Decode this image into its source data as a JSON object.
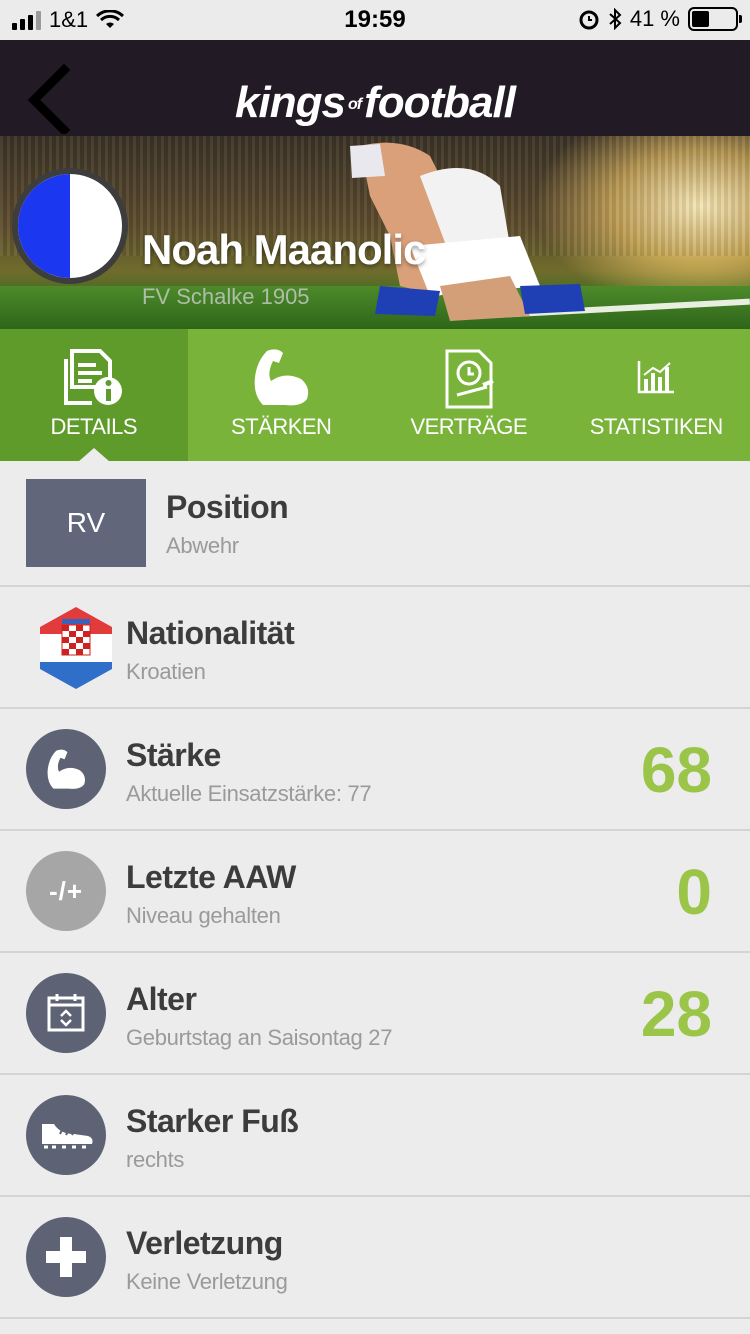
{
  "status_bar": {
    "carrier": "1&1",
    "time": "19:59",
    "battery_percent": "41 %",
    "battery_level": 0.41
  },
  "nav": {
    "back_icon": "chevron-left-icon",
    "logo_part1": "kings",
    "logo_part2": "of",
    "logo_part3": "football"
  },
  "player": {
    "name": "Noah Maanolic",
    "club": "FV Schalke 1905",
    "club_colors": [
      "#1b38f0",
      "#ffffff"
    ]
  },
  "tabs": [
    {
      "label": "DETAILS",
      "icon": "details-document-icon",
      "active": true
    },
    {
      "label": "STÄRKEN",
      "icon": "flexed-arm-icon",
      "active": false
    },
    {
      "label": "VERTRÄGE",
      "icon": "contract-clock-icon",
      "active": false
    },
    {
      "label": "STATISTIKEN",
      "icon": "bar-chart-icon",
      "active": false
    }
  ],
  "details": {
    "position": {
      "badge": "RV",
      "title": "Position",
      "subtitle": "Abwehr"
    },
    "nationality": {
      "title": "Nationalität",
      "subtitle": "Kroatien",
      "icon": "croatia-flag-icon"
    },
    "strength": {
      "title": "Stärke",
      "subtitle": "Aktuelle Einsatzstärke: 77",
      "value": "68",
      "icon": "flexed-arm-icon"
    },
    "last_aaw": {
      "title": "Letzte AAW",
      "subtitle": "Niveau gehalten",
      "value": "0",
      "icon_text": "-/+"
    },
    "age": {
      "title": "Alter",
      "subtitle": "Geburtstag an Saisontag 27",
      "value": "28",
      "icon": "calendar-icon"
    },
    "foot": {
      "title": "Starker Fuß",
      "subtitle": "rechts",
      "icon": "football-boot-icon"
    },
    "injury": {
      "title": "Verletzung",
      "subtitle": "Keine Verletzung",
      "icon": "medical-cross-icon"
    }
  },
  "colors": {
    "accent_green": "#79b33a",
    "value_green": "#9bc548",
    "navbar": "#221b25",
    "icon_circle": "#5d6274"
  }
}
